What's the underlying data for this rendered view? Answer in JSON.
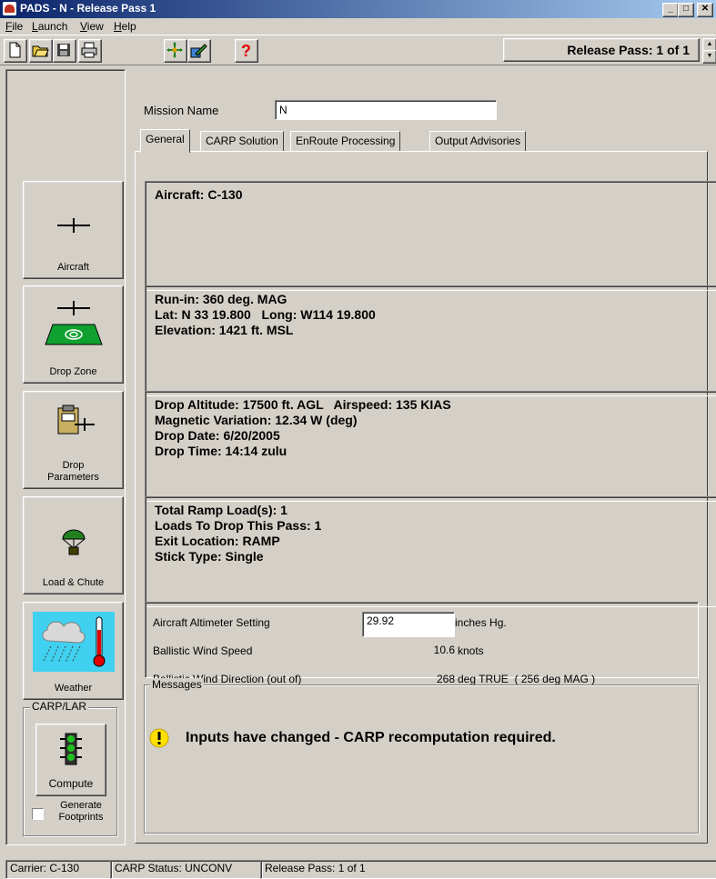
{
  "window": {
    "title": "PADS - N - Release Pass 1"
  },
  "menu": [
    {
      "label": "File",
      "accel": "F",
      "rest": "ile"
    },
    {
      "label": "Launch",
      "accel": "L",
      "rest": "aunch"
    },
    {
      "label": "View",
      "accel": "V",
      "rest": "iew"
    },
    {
      "label": "Help",
      "accel": "H",
      "rest": "elp"
    }
  ],
  "toolbar": {
    "icons": [
      "new-document-icon",
      "open-folder-icon",
      "save-disk-icon",
      "print-icon",
      "crosshair-move-icon",
      "edit-draw-icon",
      "help-question-icon"
    ],
    "release_pass": "Release Pass: 1 of 1"
  },
  "nav": {
    "aircraft": "Aircraft",
    "drop_zone": "Drop Zone",
    "drop_parameters_1": "Drop",
    "drop_parameters_2": "Parameters",
    "load_chute": "Load & Chute",
    "weather": "Weather",
    "carp_group": "CARP/LAR",
    "compute": "Compute",
    "generate_1": "Generate",
    "generate_2": "Footprints"
  },
  "mission": {
    "label": "Mission Name",
    "value": "N"
  },
  "tabs": [
    "General",
    "CARP Solution",
    "EnRoute Processing",
    "Output Advisories"
  ],
  "aircraft_box": {
    "line1": "Aircraft: C-130"
  },
  "dropzone_box": {
    "line1": "Run-in: 360 deg. MAG",
    "line2": "Lat: N 33 19.800   Long: W114 19.800",
    "line3": "Elevation: 1421 ft. MSL"
  },
  "params_box": {
    "line1": "Drop Altitude: 17500 ft. AGL   Airspeed: 135 KIAS",
    "line2": "Magnetic Variation: 12.34 W (deg)",
    "line3": "Drop Date: 6/20/2005",
    "line4": "Drop Time: 14:14 zulu"
  },
  "load_box": {
    "line1": "Total Ramp Load(s): 1",
    "line2": "Loads To Drop This Pass: 1",
    "line3": "Exit Location: RAMP",
    "line4": "Stick Type: Single"
  },
  "weather": {
    "altimeter_label": "Aircraft Altimeter Setting",
    "altimeter_value": "29.92",
    "altimeter_unit": "inches Hg.",
    "wind_speed_label": "Ballistic Wind Speed",
    "wind_speed_value": "10.6",
    "wind_speed_unit": "knots",
    "wind_dir_label": "Ballistic Wind Direction (out of)",
    "wind_dir_value": "268",
    "wind_dir_unit": "deg TRUE  ( 256 deg MAG )"
  },
  "messages": {
    "legend": "Messages",
    "text": "Inputs have changed - CARP recomputation required."
  },
  "status": {
    "carrier": "Carrier: C-130",
    "carp": "CARP Status: UNCONV",
    "pass": "Release Pass: 1 of 1"
  },
  "colors": {
    "titlebar_start": "#0a246a",
    "titlebar_end": "#a6caf0",
    "face": "#d4d0c8",
    "warning": "#ffe000",
    "dropzone_green": "#10a030"
  }
}
